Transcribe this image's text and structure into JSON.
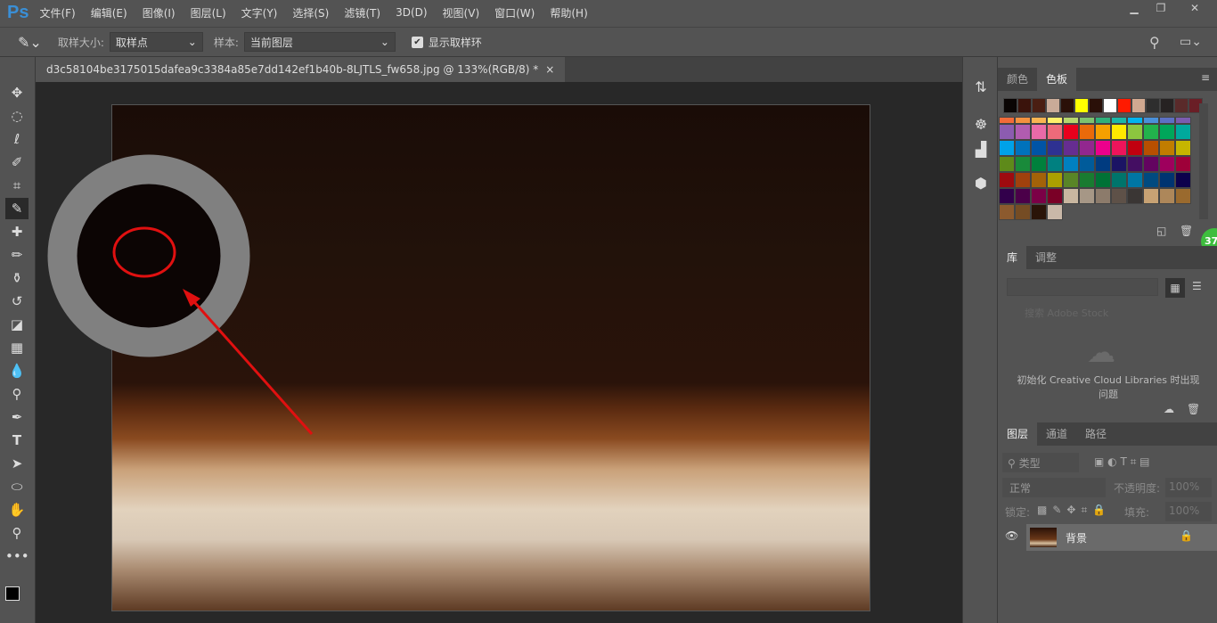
{
  "app": {
    "logo": "Ps"
  },
  "menu": [
    "文件(F)",
    "编辑(E)",
    "图像(I)",
    "图层(L)",
    "文字(Y)",
    "选择(S)",
    "滤镜(T)",
    "3D(D)",
    "视图(V)",
    "窗口(W)",
    "帮助(H)"
  ],
  "options": {
    "sample_size_label": "取样大小:",
    "sample_size_value": "取样点",
    "sample_label": "样本:",
    "sample_value": "当前图层",
    "show_ring_label": "显示取样环",
    "show_ring_checked": true
  },
  "document": {
    "tab_title": "d3c58104be3175015dafea9c3384a85e7dd142ef1b40b-8LJTLS_fw658.jpg @ 133%(RGB/8) *",
    "close": "×"
  },
  "swatches_panel": {
    "tabs": [
      "颜色",
      "色板"
    ],
    "active": "色板",
    "recent": [
      "#0a0504",
      "#3a130b",
      "#4a1e12",
      "#c9ab98",
      "#2a1008",
      "#ffff00",
      "#2a1008",
      "#ffffff",
      "#ff1a00",
      "#d0a890",
      "#2e2e2e",
      "#262222",
      "#5a2a2a",
      "#6a1e26"
    ],
    "grid": [
      "#f26b3a",
      "#f3913f",
      "#f8b552",
      "#fff06a",
      "#b6d66e",
      "#7dc36f",
      "#2fb07a",
      "#1cb7a8",
      "#00b4ef",
      "#4a90d9",
      "#5c70c4",
      "#7b5cb0",
      "#8c5cb0",
      "#b05cb0",
      "#e86aa8",
      "#ee6a7a",
      "#e8001c",
      "#ea6a0a",
      "#f5a000",
      "#ffe900",
      "#8cc63f",
      "#22b24c",
      "#00a65a",
      "#00a99d",
      "#00a2e8",
      "#0072bc",
      "#0054a6",
      "#2e3192",
      "#662d91",
      "#92278f",
      "#ec008c",
      "#ed145b",
      "#c1000f",
      "#b74f00",
      "#c17d00",
      "#c6b500",
      "#5e8a1a",
      "#198a3a",
      "#00803c",
      "#008080",
      "#0080c0",
      "#005b9a",
      "#003b80",
      "#1b1464",
      "#440e62",
      "#630460",
      "#9e005d",
      "#9e0039",
      "#9e0b0f",
      "#a0410d",
      "#a36209",
      "#aba000",
      "#598527",
      "#197b30",
      "#007236",
      "#00746b",
      "#0076a3",
      "#004a80",
      "#003471",
      "#0d004c",
      "#32004b",
      "#4b0049",
      "#7b0046",
      "#7a0026",
      "#c9b7a0",
      "#a69786",
      "#8c7b6b",
      "#5e5148",
      "#3a3634",
      "#c7a274",
      "#ad875a",
      "#9a6a2e",
      "#8c5a2e",
      "#754c24",
      "#2a1408",
      "#c9b8a8"
    ]
  },
  "library_panel": {
    "tabs": [
      "库",
      "调整"
    ],
    "search_placeholder": "搜索 Adobe Stock",
    "message": "初始化 Creative Cloud Libraries 时出现问题"
  },
  "layers_panel": {
    "tabs": [
      "图层",
      "通道",
      "路径"
    ],
    "filter_label": "类型",
    "blend_mode": "正常",
    "opacity_label": "不透明度:",
    "opacity_value": "100%",
    "lock_label": "锁定:",
    "fill_label": "填充:",
    "fill_value": "100%",
    "layers": [
      {
        "name": "背景",
        "visible": true,
        "locked": true
      }
    ]
  },
  "badge": "37"
}
